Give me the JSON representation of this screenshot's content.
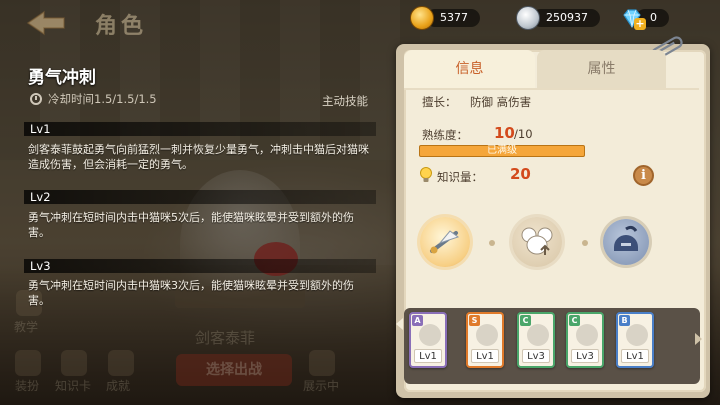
{
  "header": {
    "title": "角色"
  },
  "currency": {
    "gold": "5377",
    "silver": "250937",
    "diamond": "0",
    "plus_label": "+"
  },
  "skill": {
    "name": "勇气冲刺",
    "cooldown": "冷却时间1.5/1.5/1.5",
    "type": "主动技能",
    "levels": [
      {
        "title": "Lv1",
        "desc": "剑客泰菲鼓起勇气向前猛烈一刺并恢复少量勇气，冲刺击中猫后对猫咪造成伤害，但会消耗一定的勇气。"
      },
      {
        "title": "Lv2",
        "desc": "勇气冲刺在短时间内击中猫咪5次后，能使猫咪眩晕并受到额外的伤害。"
      },
      {
        "title": "Lv3",
        "desc": "勇气冲刺在短时间内击中猫咪3次后，能使猫咪眩晕并受到额外的伤害。"
      }
    ]
  },
  "bottom_nav": {
    "items": [
      "装扮",
      "知识卡",
      "成就",
      "展示中"
    ],
    "left_label": "教学",
    "center_text": "剑客泰菲",
    "action_button": "选择出战"
  },
  "info_panel": {
    "tabs": [
      {
        "label": "信息",
        "active": true
      },
      {
        "label": "属性",
        "active": false
      }
    ],
    "specialty_label": "擅长：",
    "specialty_values": "防御  高伤害",
    "mastery_label": "熟练度：",
    "mastery_value": "10",
    "mastery_max": "/10",
    "mastery_bar_text": "已满级",
    "mastery_progress": 1.0,
    "knowledge_label": "知识量：",
    "knowledge_value": "20",
    "info_icon": "i"
  },
  "cards": [
    {
      "grade": "A",
      "level": "Lv1",
      "color": "#8a6fb8"
    },
    {
      "grade": "S",
      "level": "Lv1",
      "color": "#e07a2a"
    },
    {
      "grade": "C",
      "level": "Lv3",
      "color": "#4aa66a"
    },
    {
      "grade": "C",
      "level": "Lv3",
      "color": "#4aa66a"
    },
    {
      "grade": "B",
      "level": "Lv1",
      "color": "#4a7fc8"
    }
  ],
  "colors": {
    "accent": "#c8612a",
    "highlight": "#d34a1c",
    "bar": "#f5a63a"
  }
}
